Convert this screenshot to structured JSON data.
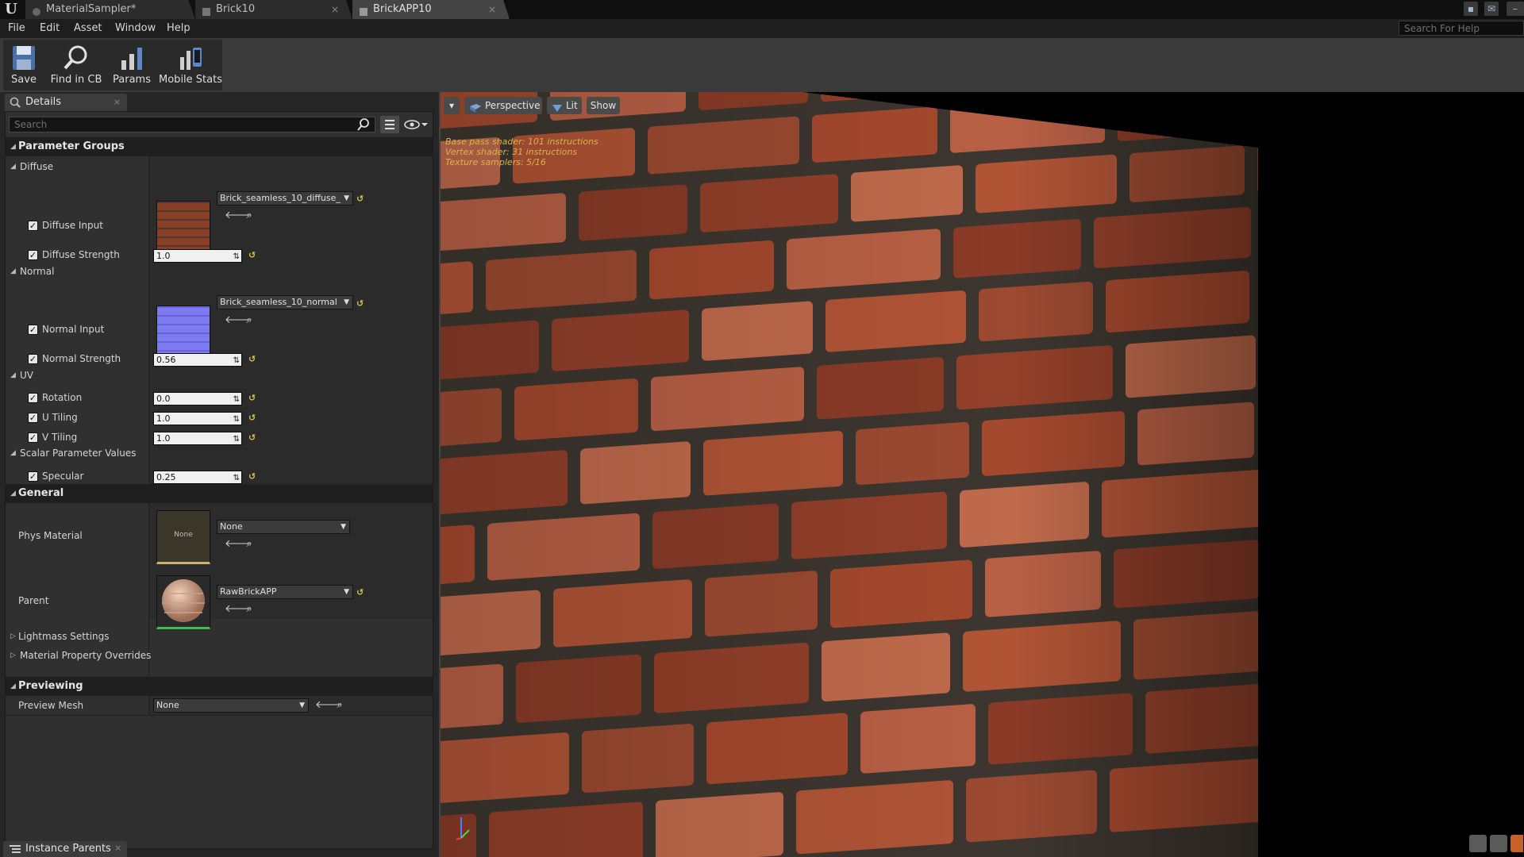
{
  "tabs": [
    {
      "label": "MaterialSampler*",
      "close": ""
    },
    {
      "label": "Brick10",
      "close": "×"
    },
    {
      "label": "BrickAPP10",
      "close": "×"
    }
  ],
  "menu": [
    "File",
    "Edit",
    "Asset",
    "Window",
    "Help"
  ],
  "help_search": {
    "placeholder": "Search For Help"
  },
  "toolbar": {
    "save": "Save",
    "find": "Find in CB",
    "params": "Params",
    "mobile": "Mobile Stats"
  },
  "details": {
    "tab_label": "Details",
    "tab_close": "×",
    "search_placeholder": "Search",
    "param_groups": "Parameter Groups",
    "diffuse": {
      "group": "Diffuse",
      "input_label": "Diffuse Input",
      "input_asset": "Brick_seamless_10_diffuse_",
      "strength_label": "Diffuse Strength",
      "strength": "1.0"
    },
    "normal": {
      "group": "Normal",
      "input_label": "Normal Input",
      "input_asset": "Brick_seamless_10_normal",
      "strength_label": "Normal Strength",
      "strength": "0.56"
    },
    "uv": {
      "group": "UV",
      "rotation_label": "Rotation",
      "rotation": "0.0",
      "utiling_label": "U Tiling",
      "utiling": "1.0",
      "vtiling_label": "V Tiling",
      "vtiling": "1.0"
    },
    "scalar": {
      "group": "Scalar Parameter Values",
      "specular_label": "Specular",
      "specular": "0.25"
    },
    "general": {
      "title": "General",
      "phys_label": "Phys Material",
      "phys_thumb": "None",
      "phys_value": "None",
      "parent_label": "Parent",
      "parent_value": "RawBrickAPP",
      "lightmass": "Lightmass Settings",
      "overrides": "Material Property Overrides"
    },
    "previewing": {
      "title": "Previewing",
      "mesh_label": "Preview Mesh",
      "mesh_value": "None"
    }
  },
  "viewport": {
    "perspective": "Perspective",
    "lit": "Lit",
    "show": "Show",
    "stats": [
      "Base pass shader: 101 instructions",
      "Vertex shader: 31 instructions",
      "Texture samplers: 5/16"
    ]
  },
  "bottom_tab": "Instance Parents",
  "colors": {
    "accent": "#d7c542",
    "panel": "#303030",
    "brick": "#a14a30",
    "mortar": "#3f3a34"
  }
}
